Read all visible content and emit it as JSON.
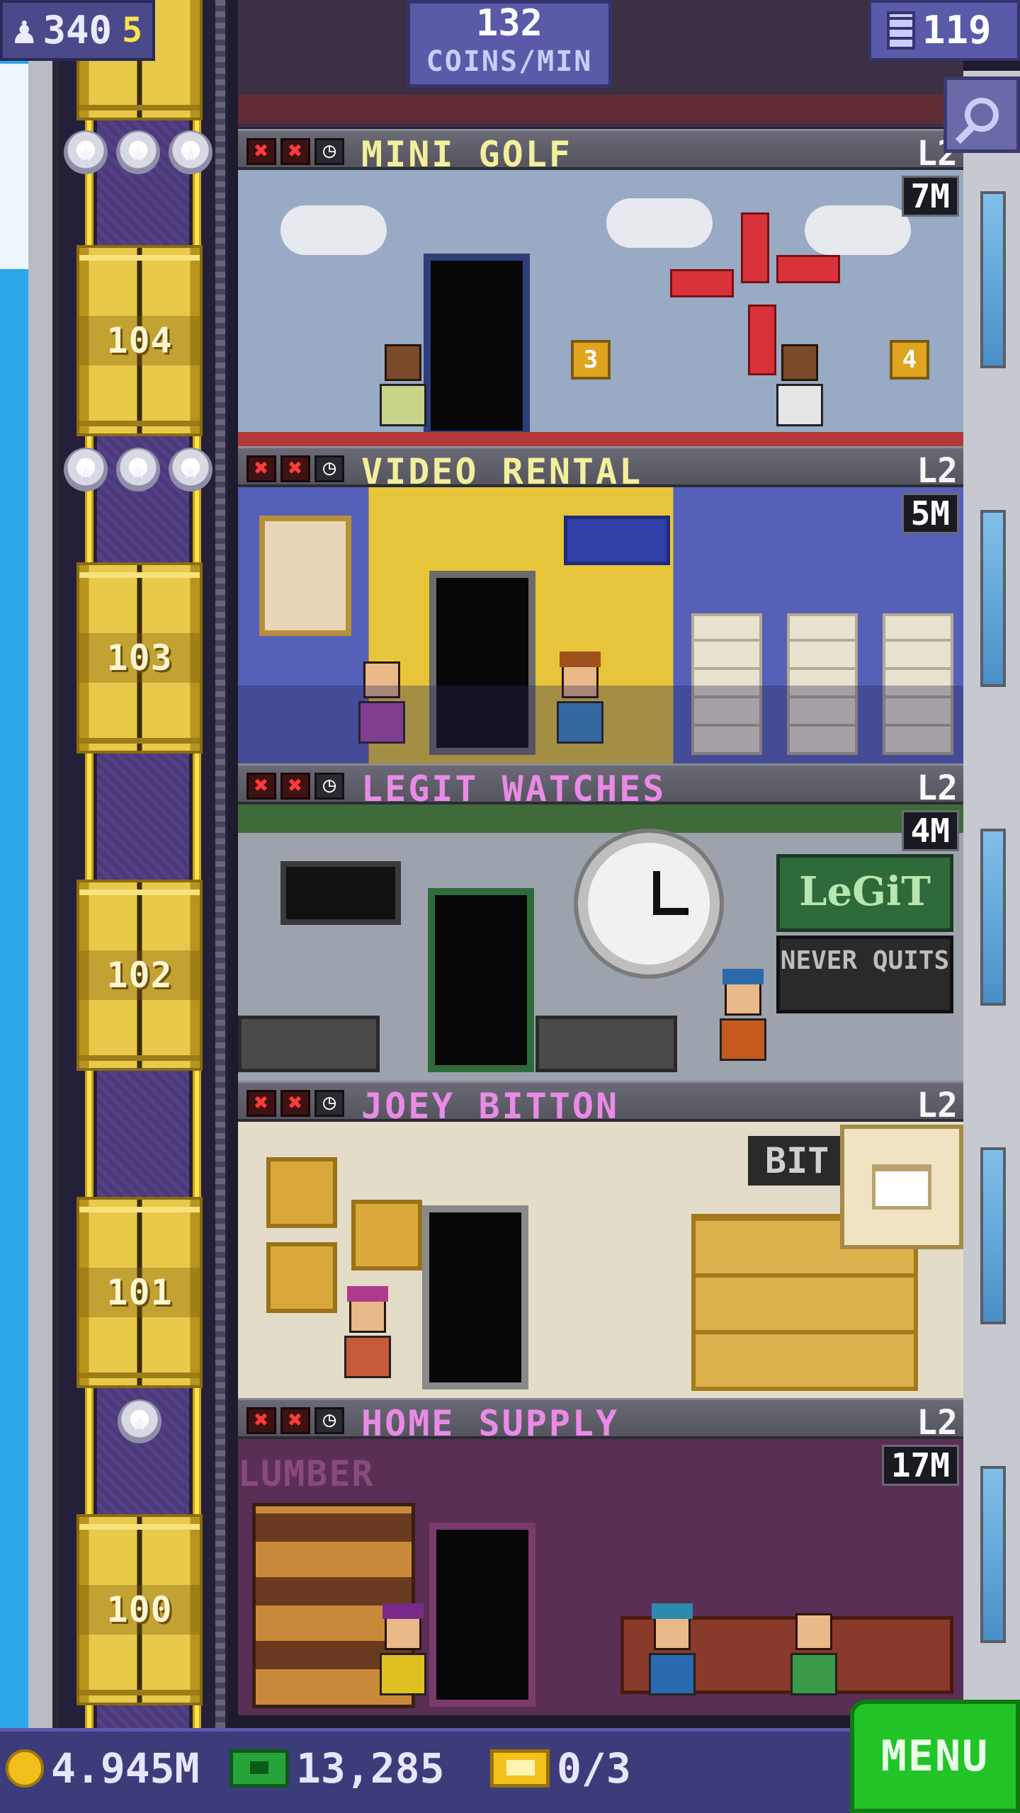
{
  "top": {
    "population": "340",
    "current_floor_label": "5",
    "coins_per_min_value": "132",
    "coins_per_min_unit": "COINS/MIN",
    "floor_count": "119"
  },
  "elevator": {
    "cars": [
      {
        "label": "104"
      },
      {
        "label": "103"
      },
      {
        "label": "102"
      },
      {
        "label": "101"
      },
      {
        "label": "100"
      }
    ]
  },
  "floors": [
    {
      "name": "MINI GOLF",
      "level": "L2",
      "stock": "7M",
      "name_color": "#f3ef9c",
      "hole_a": "3",
      "hole_b": "4"
    },
    {
      "name": "VIDEO RENTAL",
      "level": "L2",
      "stock": "5M",
      "name_color": "#f3ef9c"
    },
    {
      "name": "LEGIT WATCHES",
      "level": "L2",
      "stock": "4M",
      "name_color": "#e98be6",
      "sign_top": "LeGiT",
      "sign_bottom": "NEVER QUITS"
    },
    {
      "name": "JOEY BITTON",
      "level": "L2",
      "name_color": "#e98be6",
      "sign": "BIT"
    },
    {
      "name": "HOME SUPPLY",
      "level": "L2",
      "stock": "17M",
      "name_color": "#e98be6",
      "sign": "LUMBER"
    }
  ],
  "bottom": {
    "coins": "4.945M",
    "bux": "13,285",
    "tickets": "0/3",
    "menu_label": "MENU"
  },
  "colors": {
    "sky": "#2aa7e8",
    "elevator_gold": "#e9c94a",
    "menu_green": "#22c428",
    "hud_blue": "#5a5aa8"
  }
}
